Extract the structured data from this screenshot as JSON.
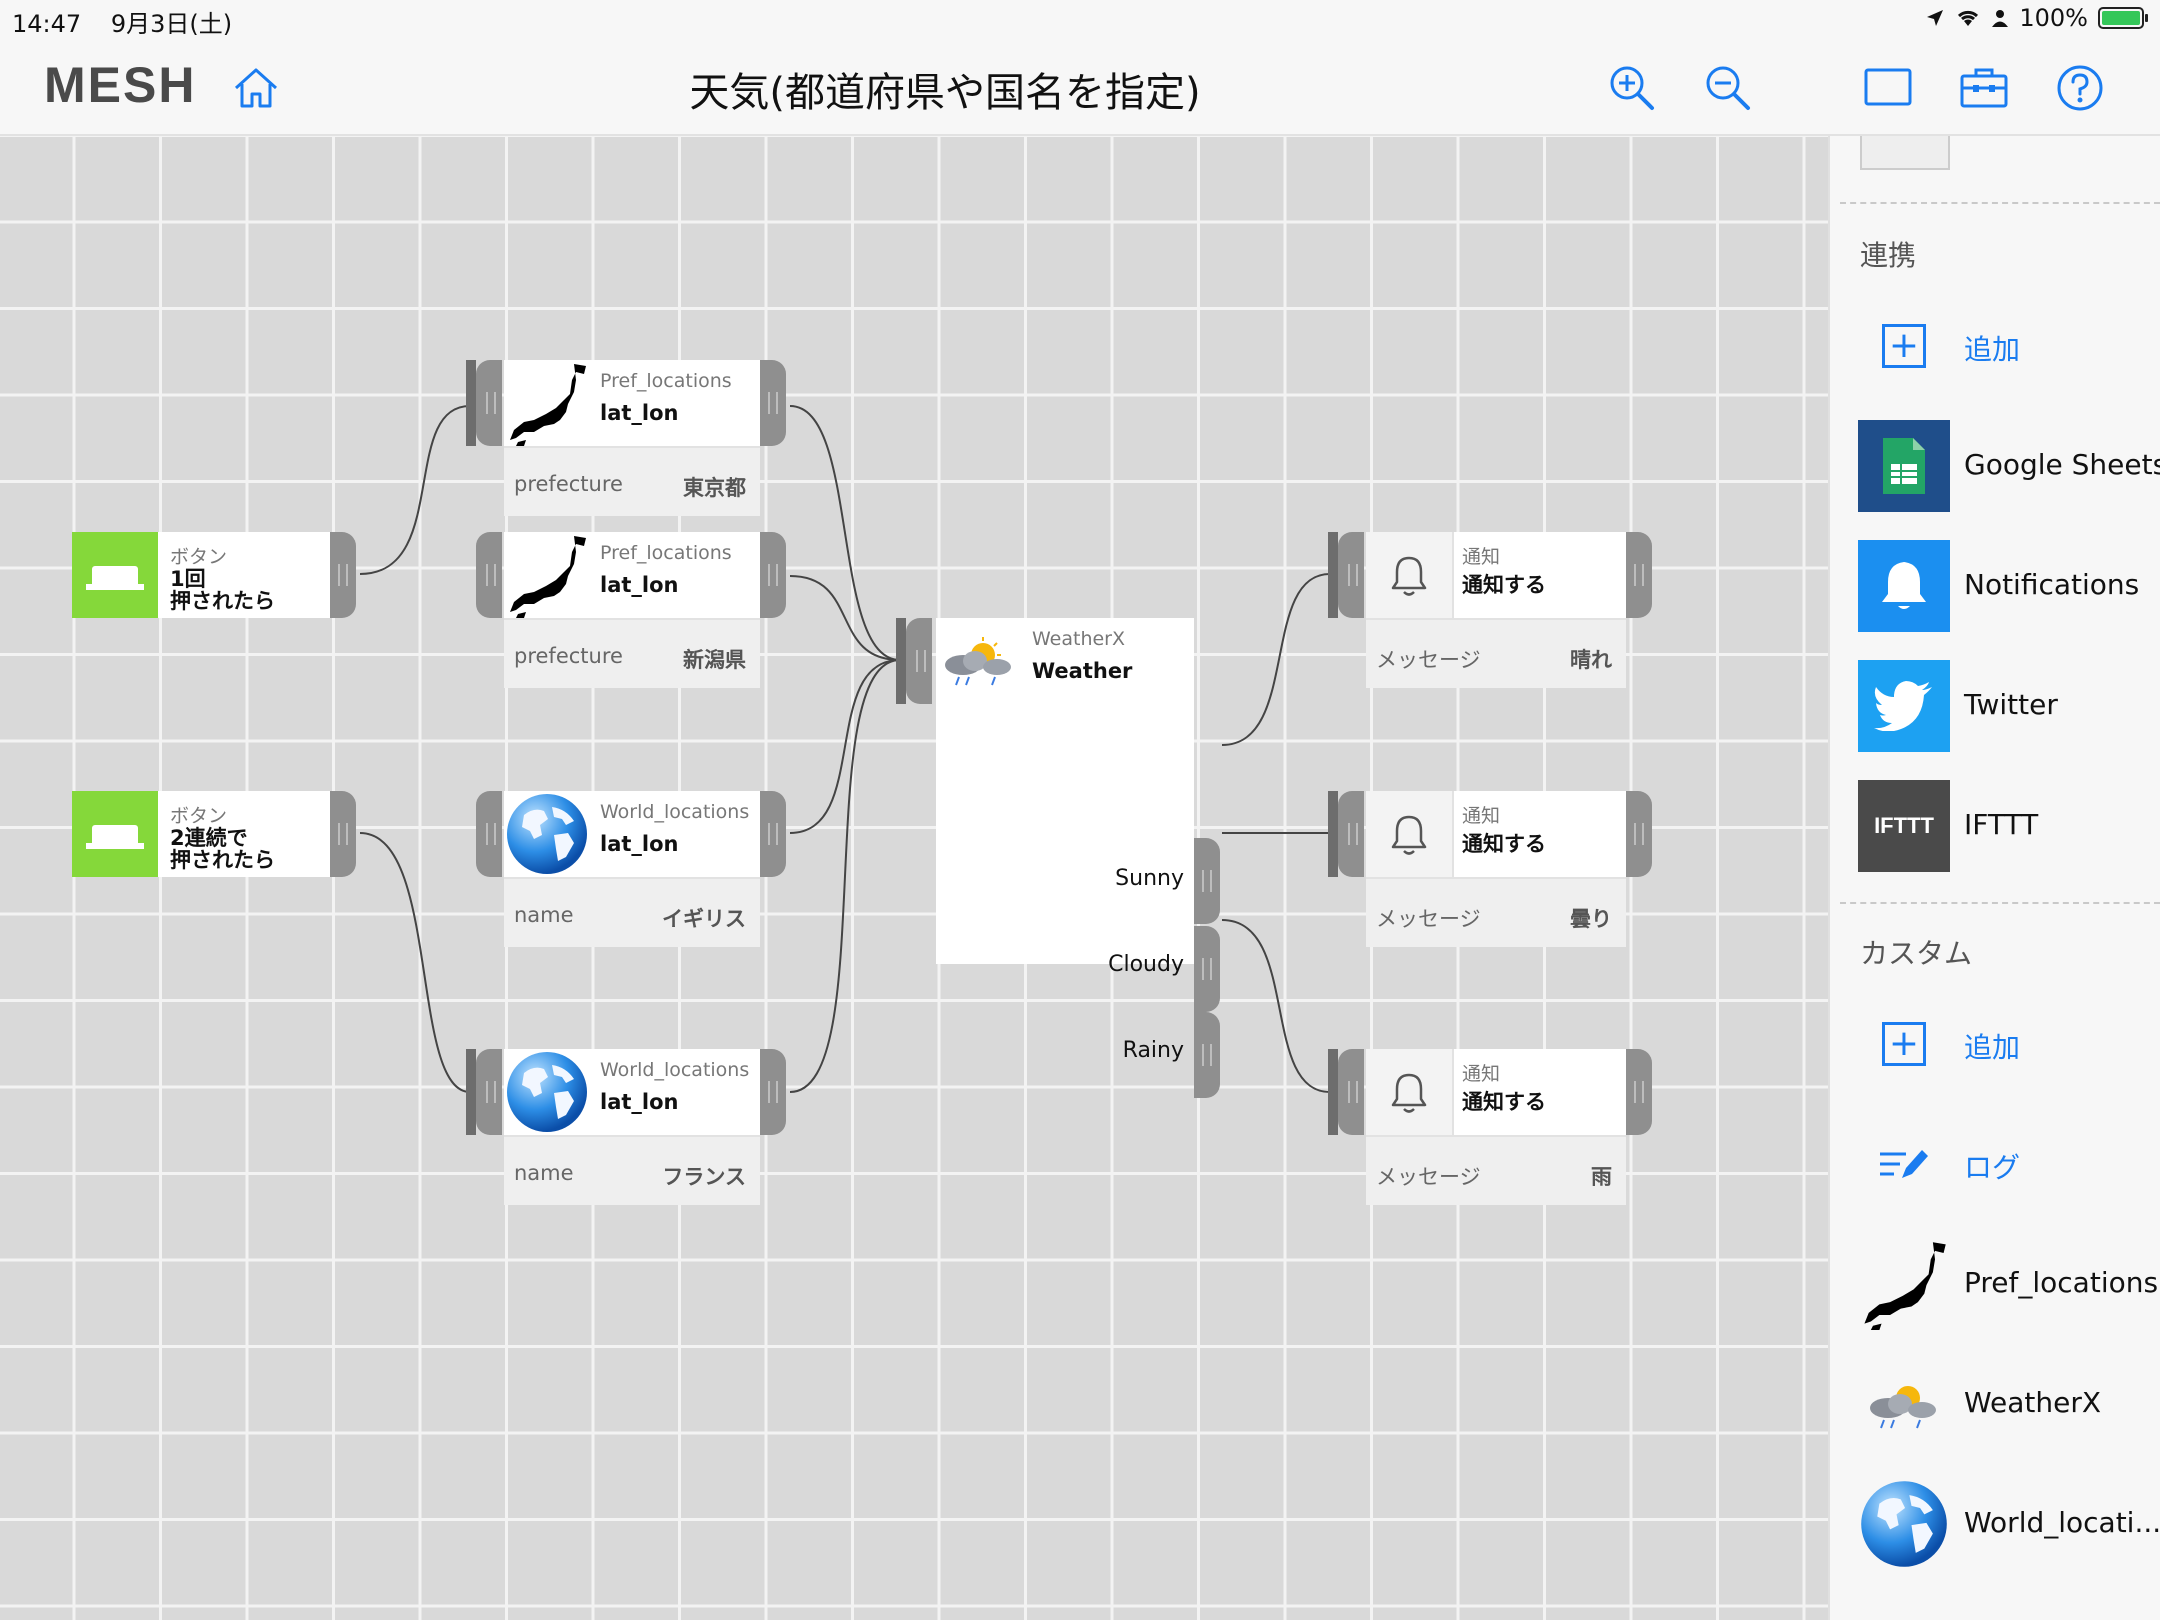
{
  "status": {
    "time": "14:47",
    "date": "9月3日(土)",
    "battery": "100%"
  },
  "header": {
    "logo": "MESH",
    "title": "天気(都道府県や国名を指定)"
  },
  "canvas": {
    "buttons": [
      {
        "label": "ボタン",
        "line1": "1回",
        "line2": "押されたら"
      },
      {
        "label": "ボタン",
        "line1": "2連続で",
        "line2": "押されたら"
      }
    ],
    "pref_blocks": [
      {
        "small": "Pref_locations",
        "big": "lat_lon",
        "prop_key": "prefecture",
        "prop_val": "東京都"
      },
      {
        "small": "Pref_locations",
        "big": "lat_lon",
        "prop_key": "prefecture",
        "prop_val": "新潟県"
      }
    ],
    "world_blocks": [
      {
        "small": "World_locations",
        "big": "lat_lon",
        "prop_key": "name",
        "prop_val": "イギリス"
      },
      {
        "small": "World_locations",
        "big": "lat_lon",
        "prop_key": "name",
        "prop_val": "フランス"
      }
    ],
    "weather": {
      "small": "WeatherX",
      "big": "Weather",
      "ports": [
        "Sunny",
        "Cloudy",
        "Rainy"
      ]
    },
    "notify_blocks": [
      {
        "small": "通知",
        "big": "通知する",
        "prop_key": "メッセージ",
        "prop_val": "晴れ"
      },
      {
        "small": "通知",
        "big": "通知する",
        "prop_key": "メッセージ",
        "prop_val": "曇り"
      },
      {
        "small": "通知",
        "big": "通知する",
        "prop_key": "メッセージ",
        "prop_val": "雨"
      }
    ]
  },
  "sidebar": {
    "sections": {
      "linkage": "連携",
      "custom": "カスタム"
    },
    "linkage_items": [
      {
        "label": "追加",
        "icon": "plus-icon"
      },
      {
        "label": "Google Sheets",
        "icon": "google-sheets-icon"
      },
      {
        "label": "Notifications",
        "icon": "bell-icon"
      },
      {
        "label": "Twitter",
        "icon": "twitter-icon"
      },
      {
        "label": "IFTTT",
        "icon": "ifttt-icon"
      }
    ],
    "custom_items": [
      {
        "label": "追加",
        "icon": "plus-icon"
      },
      {
        "label": "ログ",
        "icon": "log-icon"
      },
      {
        "label": "Pref_locations",
        "icon": "japan-map-icon"
      },
      {
        "label": "WeatherX",
        "icon": "weather-icon"
      },
      {
        "label": "World_locati...",
        "icon": "globe-icon"
      }
    ],
    "ifttt_text": "IFTTT"
  },
  "colors": {
    "accent": "#1a7cf0",
    "button_green": "#85d83a",
    "connector": "#8f8f8f",
    "grid_line": "#f3f3f3",
    "canvas_bg": "#d9d9d9"
  }
}
